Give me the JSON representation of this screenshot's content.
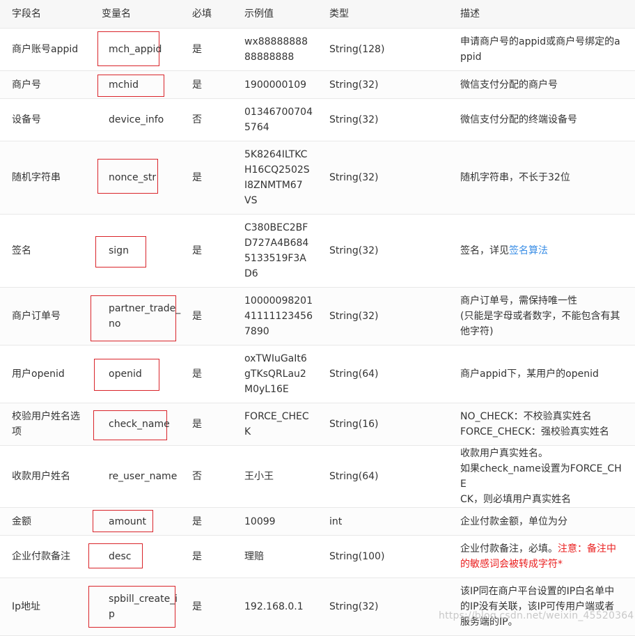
{
  "headers": [
    "字段名",
    "变量名",
    "必填",
    "示例值",
    "类型",
    "描述"
  ],
  "rows": [
    {
      "name": "商户账号appid",
      "var": "mch_appid",
      "req": "是",
      "ex": [
        "wx88888888",
        "88888888"
      ],
      "type": "String(128)",
      "desc": [
        "申请商户号的appid或商户号绑定的a",
        "ppid"
      ]
    },
    {
      "name": "商户号",
      "var": "mchid",
      "req": "是",
      "ex": [
        "1900000109"
      ],
      "type": "String(32)",
      "desc": [
        "微信支付分配的商户号"
      ]
    },
    {
      "name": "设备号",
      "var": "device_info",
      "req": "否",
      "ex": [
        "01346700704",
        "5764"
      ],
      "type": "String(32)",
      "desc": [
        "微信支付分配的终端设备号"
      ]
    },
    {
      "name": "随机字符串",
      "var": "nonce_str",
      "req": "是",
      "ex": [
        "5K8264ILTKC",
        "H16CQ2502S",
        "I8ZNMTM67",
        "VS"
      ],
      "type": "String(32)",
      "desc": [
        "随机字符串，不长于32位"
      ]
    },
    {
      "name": "签名",
      "var": "sign",
      "req": "是",
      "ex": [
        "C380BEC2BF",
        "D727A4B684",
        "5133519F3A",
        "D6"
      ],
      "type": "String(32)",
      "desc_prefix": "签名，详见",
      "desc_link": "签名算法"
    },
    {
      "name": "商户订单号",
      "var": [
        "partner_trade_",
        "no"
      ],
      "req": "是",
      "ex": [
        "10000098201",
        "41111123456",
        "7890"
      ],
      "type": "String(32)",
      "desc": [
        "商户订单号，需保持唯一性",
        "(只能是字母或者数字，不能包含有其",
        "他字符)"
      ]
    },
    {
      "name": "用户openid",
      "var": "openid",
      "req": "是",
      "ex": [
        "oxTWIuGaIt6",
        "gTKsQRLau2",
        "M0yL16E"
      ],
      "type": "String(64)",
      "desc": [
        "商户appid下，某用户的openid"
      ]
    },
    {
      "name": [
        "校验用户姓名选",
        "项"
      ],
      "var": "check_name",
      "req": "是",
      "ex": [
        "FORCE_CHEC",
        "K"
      ],
      "type": "String(16)",
      "desc": [
        "NO_CHECK：不校验真实姓名",
        "FORCE_CHECK：强校验真实姓名"
      ]
    },
    {
      "name": "收款用户姓名",
      "var": "re_user_name",
      "req": "否",
      "ex": [
        "王小王"
      ],
      "type": "String(64)",
      "desc": [
        "收款用户真实姓名。",
        "如果check_name设置为FORCE_CHE",
        "CK，则必填用户真实姓名"
      ]
    },
    {
      "name": "金额",
      "var": "amount",
      "req": "是",
      "ex": [
        "10099"
      ],
      "type": "int",
      "desc": [
        "企业付款金额，单位为分"
      ]
    },
    {
      "name": "企业付款备注",
      "var": "desc",
      "req": "是",
      "ex": [
        "理赔"
      ],
      "type": "String(100)",
      "desc_prefix": "企业付款备注，必填。",
      "desc_red": [
        "注意：备注中",
        "的敏感词会被转成字符*"
      ]
    },
    {
      "name": "Ip地址",
      "var": [
        "spbill_create_i",
        "p"
      ],
      "req": "是",
      "ex": [
        "192.168.0.1"
      ],
      "type": "String(32)",
      "desc": [
        "该IP同在商户平台设置的IP白名单中",
        "的IP没有关联，该IP可传用户端或者",
        "服务端的IP。"
      ]
    }
  ],
  "watermark": "https://blog.csdn.net/weixin_45520364"
}
